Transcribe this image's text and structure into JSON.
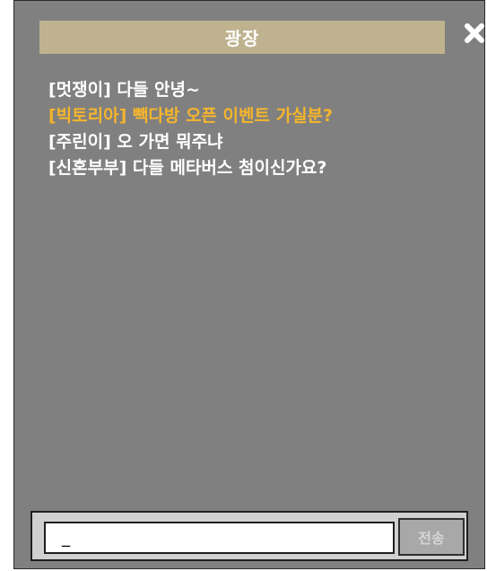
{
  "window": {
    "title": "광장",
    "close_icon": "close-x-icon"
  },
  "messages": [
    {
      "text": "[멋쟁이] 다들 안녕~",
      "color": "#ffffff"
    },
    {
      "text": "[빅토리아] 빽다방 오픈 이벤트 가실분?",
      "color": "#f5b52c"
    },
    {
      "text": "[주린이] 오 가면 뭐주냐",
      "color": "#ffffff"
    },
    {
      "text": "[신혼부부] 다들 메타버스 첨이신가요?",
      "color": "#ffffff"
    }
  ],
  "composer": {
    "input_value": "_",
    "send_label": "전송"
  },
  "colors": {
    "panel": "#808080",
    "titlebar": "#bfb28e",
    "highlight_message": "#f5b52c",
    "send_button": "#a8a8a8"
  }
}
